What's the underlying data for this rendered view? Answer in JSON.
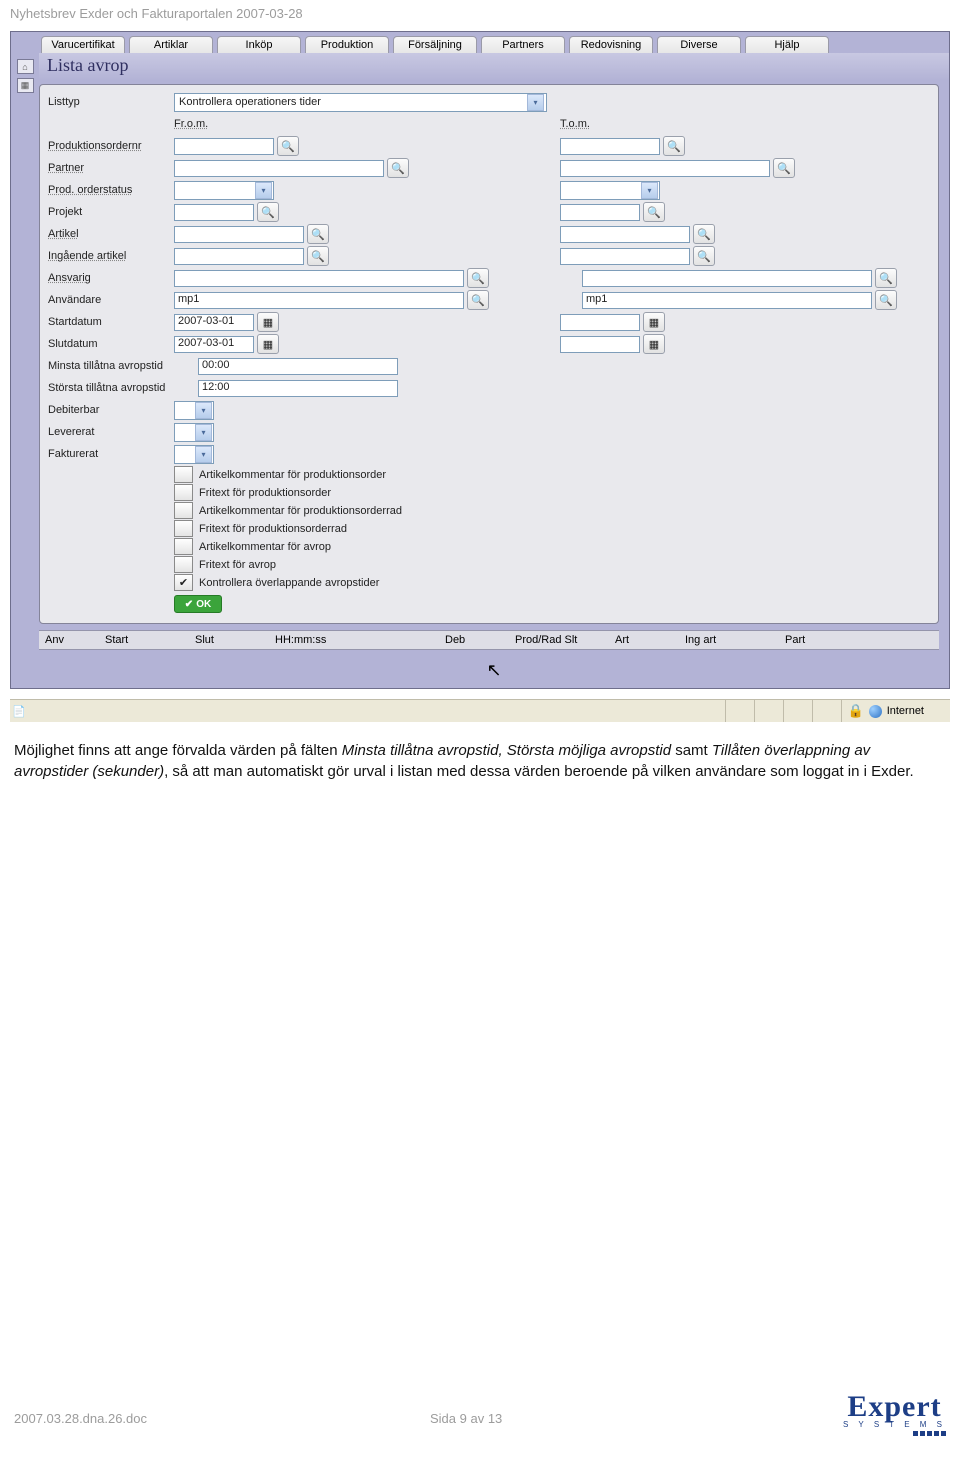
{
  "header": "Nyhetsbrev Exder och Fakturaportalen 2007-03-28",
  "menu": [
    "Varucertifikat",
    "Artiklar",
    "Inköp",
    "Produktion",
    "Försäljning",
    "Partners",
    "Redovisning",
    "Diverse",
    "Hjälp"
  ],
  "title": "Lista avrop",
  "labels": {
    "listtyp": "Listtyp",
    "fromm": "Fr.o.m.",
    "tom": "T.o.m.",
    "prodordernr": "Produktionsordernr",
    "partner": "Partner",
    "prodstatus": "Prod. orderstatus",
    "projekt": "Projekt",
    "artikel": "Artikel",
    "ingart": "Ingående artikel",
    "ansvarig": "Ansvarig",
    "anvandare": "Användare",
    "startdatum": "Startdatum",
    "slutdatum": "Slutdatum",
    "minsta": "Minsta tillåtna avropstid",
    "storsta": "Största tillåtna avropstid",
    "debiterbar": "Debiterbar",
    "levererat": "Levererat",
    "fakturerat": "Fakturerat"
  },
  "values": {
    "listtyp": "Kontrollera operationers tider",
    "anv1": "mp1",
    "anv2": "mp1",
    "start1": "2007-03-01",
    "slut1": "2007-03-01",
    "minsta": "00:00",
    "storsta": "12:00"
  },
  "checks": [
    "Artikelkommentar för produktionsorder",
    "Fritext för produktionsorder",
    "Artikelkommentar för produktionsorderrad",
    "Fritext för produktionsorderrad",
    "Artikelkommentar för avrop",
    "Fritext för avrop",
    "Kontrollera överlappande avropstider"
  ],
  "ok": "OK",
  "cols": [
    "Anv",
    "Start",
    "Slut",
    "HH:mm:ss",
    "Deb",
    "Prod/Rad Slt",
    "Art",
    "Ing art",
    "Part"
  ],
  "status": "Internet",
  "para": {
    "a": "Möjlighet finns att ange förvalda värden på fälten ",
    "b": "Minsta tillåtna avropstid, Största möjliga avropstid",
    "c": " samt ",
    "d": "Tillåten överlappning av avropstider (sekunder)",
    "e": ", så att man automatiskt gör urval i listan med dessa värden beroende på vilken användare som loggat in i Exder."
  },
  "footer": {
    "left": "2007.03.28.dna.26.doc",
    "mid": "Sida 9 av 13",
    "logo": "Expert",
    "logosub": "S Y S T E M S"
  }
}
